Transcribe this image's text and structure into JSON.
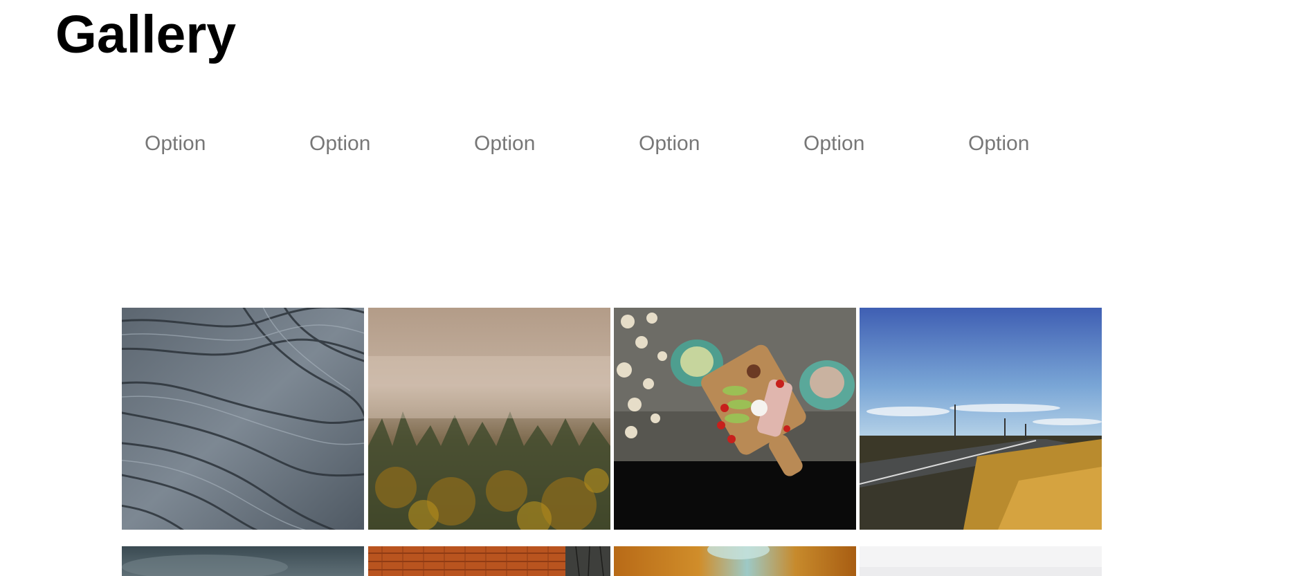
{
  "header": {
    "title": "Gallery"
  },
  "filters": {
    "options": [
      {
        "label": "Option"
      },
      {
        "label": "Option"
      },
      {
        "label": "Option"
      },
      {
        "label": "Option"
      },
      {
        "label": "Option"
      },
      {
        "label": "Option"
      }
    ]
  },
  "gallery": {
    "rows": [
      [
        {
          "subject": "wood-grain-texture"
        },
        {
          "subject": "misty-autumn-forest"
        },
        {
          "subject": "breakfast-board-with-coffee-cups"
        },
        {
          "subject": "prairie-highway-under-blue-sky"
        }
      ],
      [
        {
          "subject": "stormy-sky"
        },
        {
          "subject": "orange-tiled-roof"
        },
        {
          "subject": "autumn-foliage-blur"
        },
        {
          "subject": "pale-white-scene"
        }
      ]
    ]
  }
}
